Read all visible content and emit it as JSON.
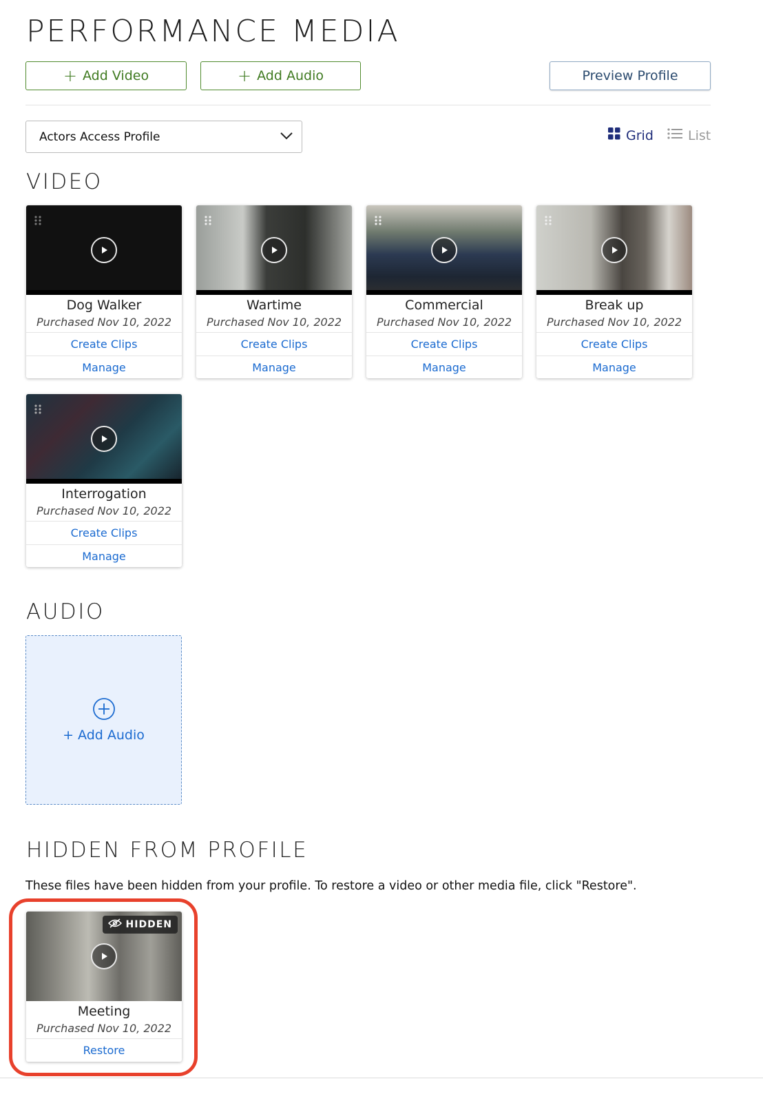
{
  "header": {
    "title": "PERFORMANCE MEDIA",
    "add_video_label": "Add Video",
    "add_audio_label": "Add Audio",
    "preview_label": "Preview Profile"
  },
  "profile_select": {
    "value": "Actors Access Profile"
  },
  "view": {
    "grid_label": "Grid",
    "list_label": "List",
    "active": "Grid"
  },
  "sections": {
    "video": "VIDEO",
    "audio": "AUDIO",
    "hidden": "HIDDEN FROM PROFILE"
  },
  "videos": [
    {
      "title": "Dog Walker",
      "date": "Purchased Nov 10, 2022",
      "create_clips": "Create Clips",
      "manage": "Manage"
    },
    {
      "title": "Wartime",
      "date": "Purchased Nov 10, 2022",
      "create_clips": "Create Clips",
      "manage": "Manage"
    },
    {
      "title": "Commercial",
      "date": "Purchased Nov 10, 2022",
      "create_clips": "Create Clips",
      "manage": "Manage"
    },
    {
      "title": "Break up",
      "date": "Purchased Nov 10, 2022",
      "create_clips": "Create Clips",
      "manage": "Manage"
    },
    {
      "title": "Interrogation",
      "date": "Purchased Nov 10, 2022",
      "create_clips": "Create Clips",
      "manage": "Manage"
    }
  ],
  "audio": {
    "add_label": "+ Add Audio"
  },
  "hidden": {
    "description": "These files have been hidden from your profile. To restore a video or other media file, click \"Restore\".",
    "items": [
      {
        "title": "Meeting",
        "date": "Purchased Nov 10, 2022",
        "badge": "HIDDEN",
        "restore": "Restore"
      }
    ]
  },
  "colors": {
    "green_button": "#3f7a20",
    "link_blue": "#1a6ad0",
    "grid_active": "#1f2d7a",
    "highlight_ring": "#e8412c",
    "audio_bg": "#e9f1fd"
  }
}
